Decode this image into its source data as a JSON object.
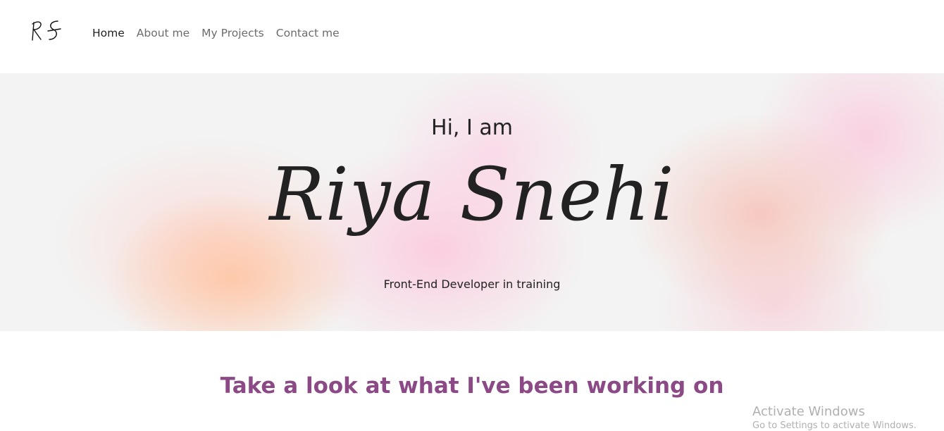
{
  "logo": {
    "text": "RS"
  },
  "nav": {
    "items": [
      {
        "label": "Home",
        "active": true
      },
      {
        "label": "About me",
        "active": false
      },
      {
        "label": "My Projects",
        "active": false
      },
      {
        "label": "Contact me",
        "active": false
      }
    ]
  },
  "hero": {
    "greeting": "Hi, I am",
    "name": "Riya Snehi",
    "tagline": "Front-End Developer in training",
    "colors": {
      "peach": "#ffc4a0",
      "pink": "#ffbed7",
      "base": "#f3f3f3"
    }
  },
  "projects": {
    "heading": "Take a look at what I've been working on",
    "heading_color": "#8b4a86"
  },
  "watermark": {
    "title": "Activate Windows",
    "subtitle": "Go to Settings to activate Windows."
  }
}
